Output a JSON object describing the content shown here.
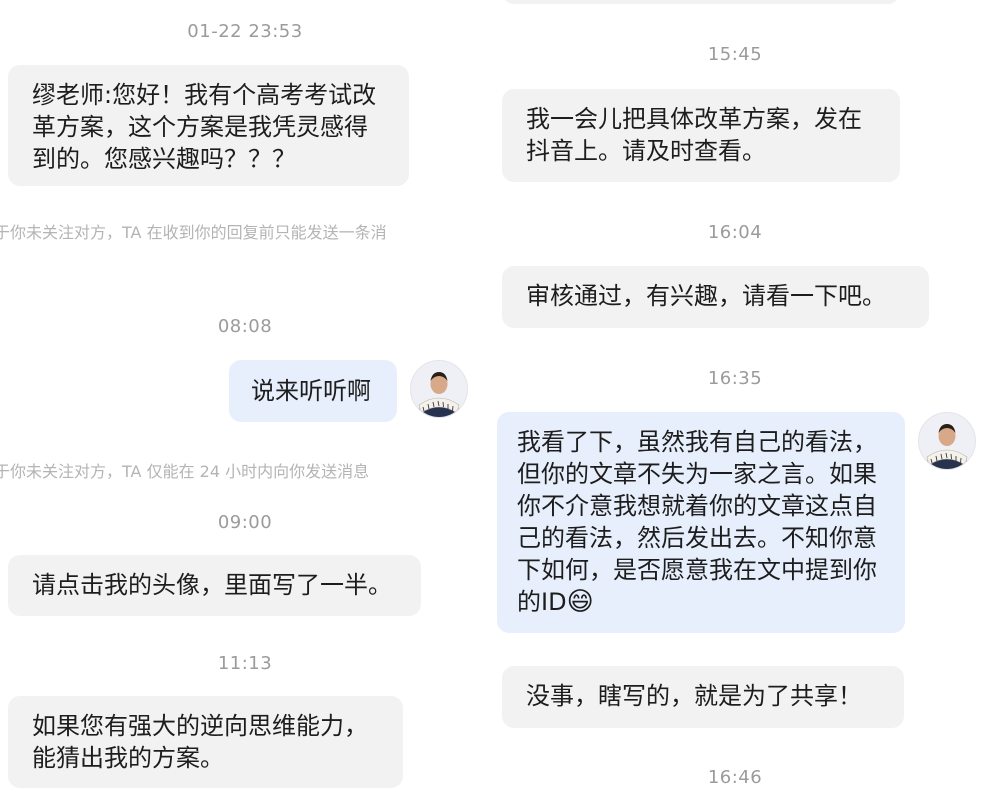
{
  "left": {
    "messages": [
      {
        "time": "01-22 23:53",
        "text": "缪老师:您好！我有个高考考试改革方案，这个方案是我凭灵感得到的。您感兴趣吗？？？"
      },
      {
        "notice": "于你未关注对方，TA 在收到你的回复前只能发送一条消"
      },
      {
        "time": "08:08",
        "text": "说来听听啊"
      },
      {
        "notice": "于你未关注对方，TA 仅能在 24 小时内向你发送消息"
      },
      {
        "time": "09:00",
        "text": "请点击我的头像，里面写了一半。"
      },
      {
        "time": "11:13",
        "text": "如果您有强大的逆向思维能力，能猜出我的方案。"
      }
    ]
  },
  "right": {
    "messages": [
      {
        "time": "15:45",
        "text": "我一会儿把具体改革方案，发在抖音上。请及时查看。"
      },
      {
        "time": "16:04",
        "text": "审核通过，有兴趣，请看一下吧。"
      },
      {
        "time": "16:35",
        "text": "我看了下，虽然我有自己的看法，但你的文章不失为一家之言。如果你不介意我想就着你的文章这点自己的看法，然后发出去。不知你意下如何，是否愿意我在文中提到你的ID",
        "emoji": "😄"
      },
      {
        "text": "没事，瞎写的，就是为了共享！"
      },
      {
        "time": "16:46"
      }
    ]
  },
  "avatar_icon": "avatar-man-with-calligraphy-fan"
}
